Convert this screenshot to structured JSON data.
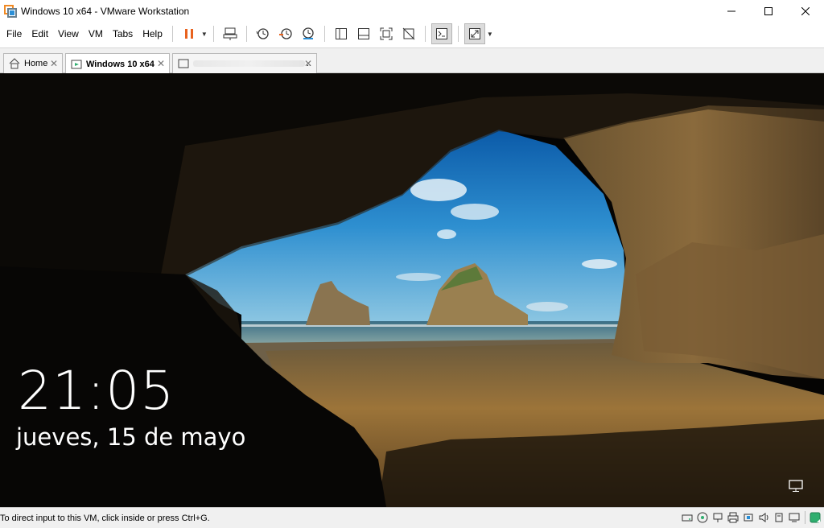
{
  "window": {
    "title": "Windows 10 x64 - VMware Workstation"
  },
  "menu": {
    "items": [
      "File",
      "Edit",
      "View",
      "VM",
      "Tabs",
      "Help"
    ]
  },
  "tabs": [
    {
      "label": "Home",
      "icon": "home-icon"
    },
    {
      "label": "Windows 10 x64",
      "icon": "vm-running-icon"
    },
    {
      "label": "..",
      "icon": "vm-icon"
    }
  ],
  "lockscreen": {
    "time": "21:05",
    "date": "jueves, 15 de mayo"
  },
  "status": {
    "text": "To direct input to this VM, click inside or press Ctrl+G."
  },
  "colors": {
    "pause_orange": "#e8621e",
    "accent_green": "#2fae6f"
  }
}
